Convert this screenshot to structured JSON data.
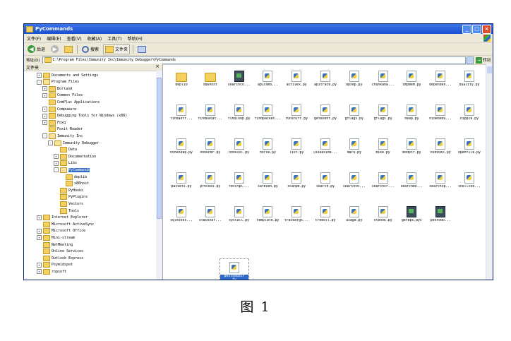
{
  "window": {
    "title": "PyCommands"
  },
  "menu": [
    "文件(F)",
    "编辑(E)",
    "查看(V)",
    "收藏(A)",
    "工具(T)",
    "帮助(H)"
  ],
  "toolbar": {
    "back": "后退",
    "search": "搜索",
    "folders": "文件夹"
  },
  "address": {
    "label": "地址(D)",
    "path": "C:\\Program Files\\Immunity Inc\\Immunity Debugger\\PyCommands",
    "go": "转到"
  },
  "tree": {
    "header": "文件夹",
    "items": [
      {
        "label": "Documents and Settings",
        "level": 1,
        "pm": "+"
      },
      {
        "label": "Program Files",
        "level": 1,
        "pm": "-"
      },
      {
        "label": "Borland",
        "level": 2,
        "pm": "+"
      },
      {
        "label": "Common Files",
        "level": 2,
        "pm": "+"
      },
      {
        "label": "ComPlus Applications",
        "level": 2,
        "pm": ""
      },
      {
        "label": "Compuware",
        "level": 2,
        "pm": "+"
      },
      {
        "label": "Debugging Tools for Windows (x86)",
        "level": 2,
        "pm": "+"
      },
      {
        "label": "Foxq",
        "level": 2,
        "pm": "+"
      },
      {
        "label": "Foxit Reader",
        "level": 2,
        "pm": ""
      },
      {
        "label": "Immunity Inc",
        "level": 2,
        "pm": "-"
      },
      {
        "label": "Immunity Debugger",
        "level": 3,
        "pm": "-"
      },
      {
        "label": "Data",
        "level": 4,
        "pm": ""
      },
      {
        "label": "Documentation",
        "level": 4,
        "pm": "+"
      },
      {
        "label": "Libs",
        "level": 4,
        "pm": "+"
      },
      {
        "label": "PyCommands",
        "level": 4,
        "pm": "-"
      },
      {
        "label": "deplib",
        "level": 5,
        "pm": ""
      },
      {
        "label": "x86host",
        "level": 5,
        "pm": ""
      },
      {
        "label": "PyHooks",
        "level": 4,
        "pm": ""
      },
      {
        "label": "PyPlugins",
        "level": 4,
        "pm": ""
      },
      {
        "label": "Vectors",
        "level": 4,
        "pm": ""
      },
      {
        "label": "Tools",
        "level": 4,
        "pm": ""
      },
      {
        "label": "Internet Explorer",
        "level": 1,
        "pm": "+"
      },
      {
        "label": "Microsoft ActiveSync",
        "level": 1,
        "pm": ""
      },
      {
        "label": "Microsoft Office",
        "level": 1,
        "pm": "+"
      },
      {
        "label": "Mini-stream",
        "level": 1,
        "pm": "+"
      },
      {
        "label": "NetMeeting",
        "level": 1,
        "pm": ""
      },
      {
        "label": "Online Services",
        "level": 1,
        "pm": ""
      },
      {
        "label": "Outlook Express",
        "level": 1,
        "pm": ""
      },
      {
        "label": "Psymidspot",
        "level": 1,
        "pm": "+"
      },
      {
        "label": "ropsoft",
        "level": 1,
        "pm": "+"
      }
    ]
  },
  "files": [
    {
      "name": "deplib",
      "type": "folder"
    },
    {
      "name": "x86host",
      "type": "folder"
    },
    {
      "name": "searchco...",
      "type": "exe"
    },
    {
      "name": "apicomb...",
      "type": "py"
    },
    {
      "name": "activex.py",
      "type": "py"
    },
    {
      "name": "apitrace.py",
      "type": "py"
    },
    {
      "name": "bpxep.py",
      "type": "py"
    },
    {
      "name": "chunkana...",
      "type": "py"
    },
    {
      "name": "cmpmem.py",
      "type": "py"
    },
    {
      "name": "dependen...",
      "type": "py"
    },
    {
      "name": "duality.py",
      "type": "py"
    },
    {
      "name": "findantr...",
      "type": "py"
    },
    {
      "name": "findDatat...",
      "type": "py"
    },
    {
      "name": "findloop.py",
      "type": "py"
    },
    {
      "name": "findpacket...",
      "type": "py"
    },
    {
      "name": "funsniff.py",
      "type": "py"
    },
    {
      "name": "getevent.py",
      "type": "py"
    },
    {
      "name": "gflags.py",
      "type": "py"
    },
    {
      "name": "gflags.py",
      "type": "py"
    },
    {
      "name": "heap.py",
      "type": "py"
    },
    {
      "name": "hidedebu...",
      "type": "py"
    },
    {
      "name": "hippie.py",
      "type": "py"
    },
    {
      "name": "hookheap.py",
      "type": "py"
    },
    {
      "name": "hookndr.py",
      "type": "py"
    },
    {
      "name": "hookssl.py",
      "type": "py"
    },
    {
      "name": "horse.py",
      "type": "py"
    },
    {
      "name": "list.py",
      "type": "py"
    },
    {
      "name": "lookaside...",
      "type": "py"
    },
    {
      "name": "mark.py",
      "type": "py"
    },
    {
      "name": "mike.py",
      "type": "py"
    },
    {
      "name": "modptr.py",
      "type": "py"
    },
    {
      "name": "nohooks.py",
      "type": "py"
    },
    {
      "name": "openfile.py",
      "type": "py"
    },
    {
      "name": "packets.py",
      "type": "py"
    },
    {
      "name": "process.py",
      "type": "py"
    },
    {
      "name": "recvtpl...",
      "type": "py"
    },
    {
      "name": "safeseh.py",
      "type": "py"
    },
    {
      "name": "scanpe.py",
      "type": "py"
    },
    {
      "name": "search.py",
      "type": "py"
    },
    {
      "name": "searchco...",
      "type": "py"
    },
    {
      "name": "searchcr...",
      "type": "py"
    },
    {
      "name": "searchbo...",
      "type": "py"
    },
    {
      "name": "searchcp...",
      "type": "py"
    },
    {
      "name": "shellcod...",
      "type": "py"
    },
    {
      "name": "sqlhooks...",
      "type": "py"
    },
    {
      "name": "stackvar...",
      "type": "py"
    },
    {
      "name": "syscall.py",
      "type": "py"
    },
    {
      "name": "template.py",
      "type": "py"
    },
    {
      "name": "traceargs...",
      "type": "py"
    },
    {
      "name": "treedll.py",
      "type": "py"
    },
    {
      "name": "usage.py",
      "type": "py"
    },
    {
      "name": "vtbook.py",
      "type": "py"
    },
    {
      "name": "getepc.pyc",
      "type": "exe"
    },
    {
      "name": "pextodo...",
      "type": "exe"
    }
  ],
  "selected_file": {
    "name_line1": "pextodobir",
    "name_line2": "ty"
  },
  "caption": "图 1"
}
